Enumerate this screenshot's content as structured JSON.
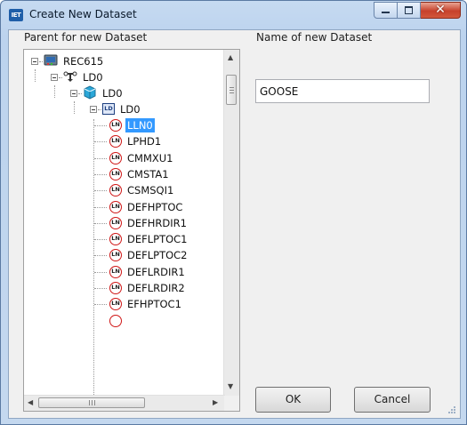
{
  "window": {
    "title": "Create New Dataset",
    "app_icon": "iet-icon",
    "controls": {
      "minimize": "minimize",
      "maximize": "maximize",
      "close": "✕"
    }
  },
  "left_pane": {
    "label": "Parent for new Dataset",
    "tree": {
      "root": {
        "label": "REC615",
        "icon": "device-icon"
      },
      "level1": {
        "label": "LD0",
        "icon": "network-icon"
      },
      "level2": {
        "label": "LD0",
        "icon": "server-icon"
      },
      "level3": {
        "label": "LD0",
        "icon": "logical-device-icon",
        "badge": "LD"
      },
      "ln_badge": "LN",
      "nodes": [
        {
          "label": "LLN0",
          "selected": true
        },
        {
          "label": "LPHD1",
          "selected": false
        },
        {
          "label": "CMMXU1",
          "selected": false
        },
        {
          "label": "CMSTA1",
          "selected": false
        },
        {
          "label": "CSMSQI1",
          "selected": false
        },
        {
          "label": "DEFHPTOC",
          "selected": false
        },
        {
          "label": "DEFHRDIR1",
          "selected": false
        },
        {
          "label": "DEFLPTOC1",
          "selected": false
        },
        {
          "label": "DEFLPTOC2",
          "selected": false
        },
        {
          "label": "DEFLRDIR1",
          "selected": false
        },
        {
          "label": "DEFLRDIR2",
          "selected": false
        },
        {
          "label": "EFHPTOC1",
          "selected": false
        }
      ]
    }
  },
  "right_pane": {
    "label": "Name of new Dataset",
    "name_value": "GOOSE"
  },
  "buttons": {
    "ok": "OK",
    "cancel": "Cancel"
  },
  "colors": {
    "selection": "#3399ff",
    "close_button": "#c7412b",
    "ln_ring": "#d01818"
  }
}
